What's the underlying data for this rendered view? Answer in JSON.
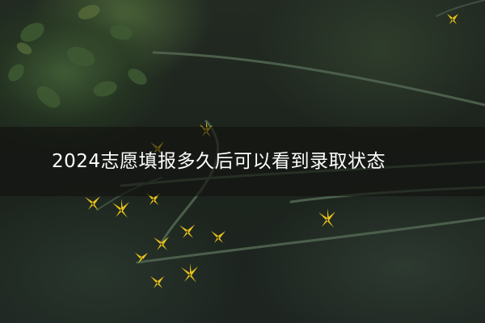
{
  "title": "2024志愿填报多久后可以看到录取状态",
  "colors": {
    "banner_overlay": "rgba(18,18,14,0.62)",
    "title_text": "#ffffff",
    "flower": "#e8c21a",
    "stem": "#4a5e4a",
    "foliage": "#3f5a34"
  }
}
